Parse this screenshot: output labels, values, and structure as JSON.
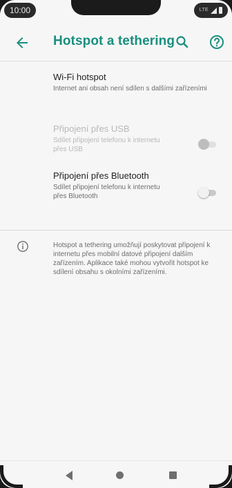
{
  "status_bar": {
    "time": "10:00",
    "network": "LTE"
  },
  "app_bar": {
    "title": "Hotspot a tethering",
    "back_icon": "arrow-back-icon",
    "search_icon": "search-icon",
    "help_icon": "help-icon"
  },
  "items": [
    {
      "title": "Wi-Fi hotspot",
      "subtitle": "Internet ani obsah není sdílen s dalšími zařízeními",
      "enabled": true
    },
    {
      "title": "Připojení přes USB",
      "subtitle": "Sdílet připojení telefonu k internetu přes USB",
      "enabled": false,
      "toggle_on": false
    },
    {
      "title": "Připojení přes Bluetooth",
      "subtitle": "Sdílet připojení telefonu k internetu přes Bluetooth",
      "enabled": true,
      "toggle_on": false
    }
  ],
  "info": {
    "icon": "info-icon",
    "text": "Hotspot a tethering umožňují poskytovat připojení k internetu přes mobilní datové připojení dalším zařízením. Aplikace také mohou vytvořit hotspot ke sdílení obsahu s okolními zařízeními."
  },
  "nav_bar": {
    "back_icon": "nav-back-icon",
    "home_icon": "nav-home-icon",
    "recents_icon": "nav-recents-icon"
  },
  "colors": {
    "accent": "#1a8f7e",
    "background": "#f6f6f6",
    "primary_text": "#222222",
    "secondary_text": "#6d6d6d",
    "disabled_text": "#b8b8b8"
  }
}
